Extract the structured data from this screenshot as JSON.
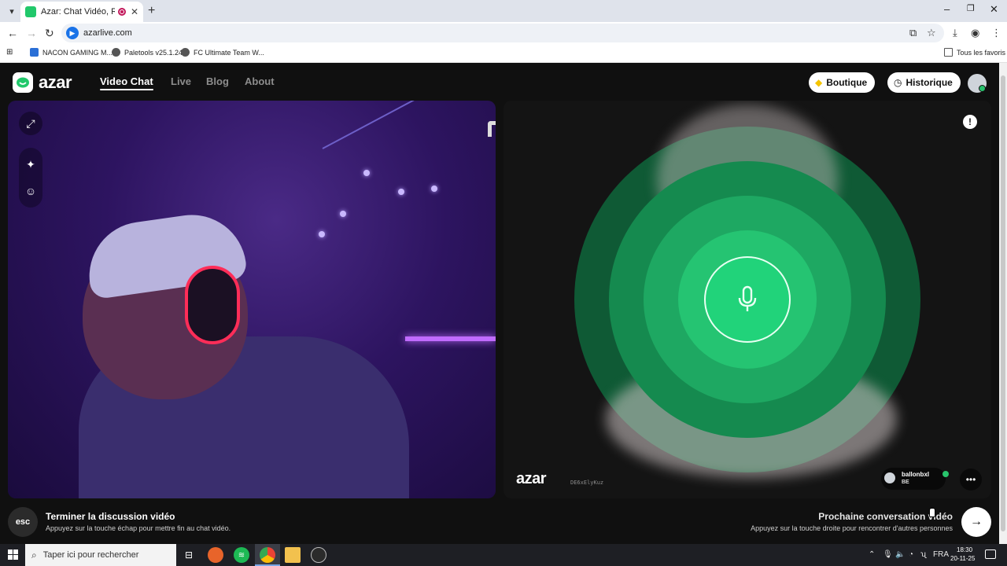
{
  "browser": {
    "tab_title": "Azar: Chat Vidéo, Rencontr",
    "url": "azarlive.com",
    "bookmarks": [
      {
        "label": "NACON GAMING M..."
      },
      {
        "label": "Paletools v25.1.24"
      },
      {
        "label": "FC Ultimate Team W..."
      }
    ],
    "all_bookmarks": "Tous les favoris",
    "colors": {
      "tab_favicon": "#21c86b",
      "recording": "#c2185b"
    }
  },
  "site": {
    "logo": "azar",
    "nav": [
      {
        "label": "Video Chat",
        "active": true
      },
      {
        "label": "Live",
        "active": false
      },
      {
        "label": "Blog",
        "active": false
      },
      {
        "label": "About",
        "active": false
      }
    ],
    "shop_label": "Boutique",
    "history_label": "Historique"
  },
  "remote": {
    "watermark": "azar",
    "session_code": "DE6xElyKuz",
    "user_name": "ballonbxl",
    "user_country": "BE",
    "accent": "#22d37a"
  },
  "bottom": {
    "esc_key": "esc",
    "end_title": "Terminer la discussion vidéo",
    "end_sub": "Appuyez sur la touche échap pour mettre fin au chat vidéo.",
    "next_title": "Prochaine conversation vidéo",
    "next_sub": "Appuyez sur la touche droite pour rencontrer d'autres personnes"
  },
  "taskbar": {
    "search_placeholder": "Taper ici pour rechercher",
    "language": "FRA",
    "time": "18:30",
    "date": "20-11-25"
  }
}
